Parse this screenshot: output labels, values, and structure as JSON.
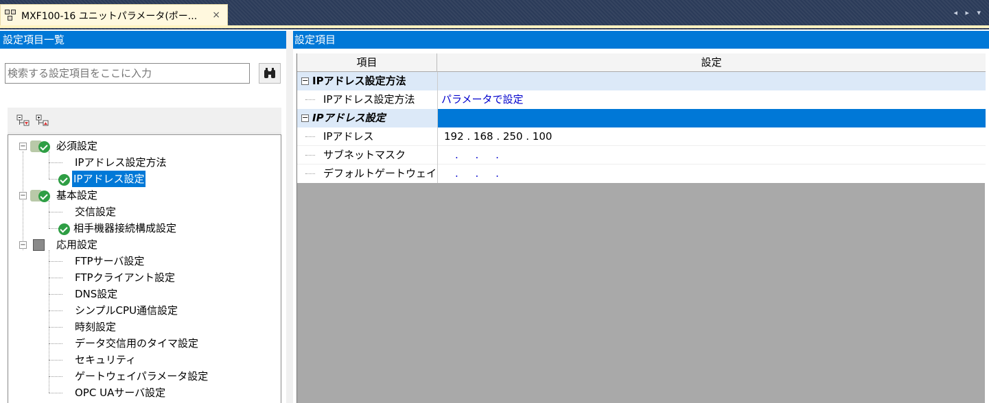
{
  "tab": {
    "title": "MXF100-16 ユニットパラメータ(ポー...",
    "close": "×",
    "nav_arrows": "◂ ▸ ▾"
  },
  "left": {
    "header": "設定項目一覧",
    "search_placeholder": "検索する設定項目をここに入力",
    "search_icon": "binoculars-icon",
    "toolbar_icons": [
      "expand-all-icon",
      "collapse-all-icon"
    ],
    "tree": {
      "hissu": "必須設定",
      "hissu_ip_method": "IPアドレス設定方法",
      "hissu_ip": "IPアドレス設定",
      "kihon": "基本設定",
      "kihon_koushin": "交信設定",
      "kihon_aite": "相手機器接続構成設定",
      "ouyou": "応用設定",
      "ouyou_items": [
        "FTPサーバ設定",
        "FTPクライアント設定",
        "DNS設定",
        "シンプルCPU通信設定",
        "時刻設定",
        "データ交信用のタイマ設定",
        "セキュリティ",
        "ゲートウェイパラメータ設定",
        "OPC UAサーバ設定"
      ]
    }
  },
  "right": {
    "header": "設定項目",
    "columns": {
      "item": "項目",
      "setting": "設定"
    },
    "group1": {
      "label": "IPアドレス設定方法"
    },
    "row_method": {
      "label": "IPアドレス設定方法",
      "value": "パラメータで設定"
    },
    "group2": {
      "label": "IPアドレス設定"
    },
    "row_ip": {
      "label": "IPアドレス",
      "value": "192 . 168 . 250 . 100"
    },
    "row_subnet": {
      "label": "サブネットマスク",
      "value": ". . ."
    },
    "row_gateway": {
      "label": "デフォルトゲートウェイ",
      "value": ". . ."
    }
  },
  "colors": {
    "accent": "#0078d7",
    "check": "#2e9e44",
    "group_bg": "#dce9f8",
    "value_blue": "#0000cc"
  }
}
